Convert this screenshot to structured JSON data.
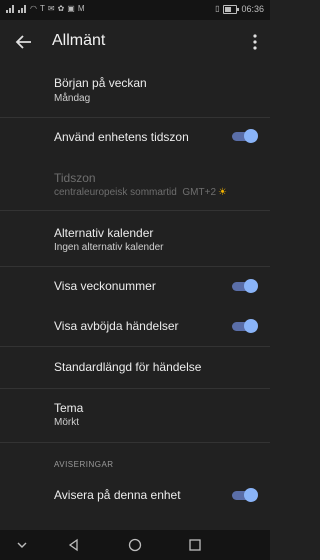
{
  "status_bar": {
    "carrier": "T",
    "time": "06:36"
  },
  "app_bar": {
    "title": "Allmänt"
  },
  "settings": {
    "week_start": {
      "title": "Början på veckan",
      "value": "Måndag"
    },
    "device_timezone": {
      "title": "Använd enhetens tidszon",
      "enabled": true
    },
    "timezone": {
      "title": "Tidszon",
      "value": "centraleuropeisk sommartid  GMT+2"
    },
    "alt_calendar": {
      "title": "Alternativ kalender",
      "value": "Ingen alternativ kalender"
    },
    "week_numbers": {
      "title": "Visa veckonummer",
      "enabled": true
    },
    "declined_events": {
      "title": "Visa avböjda händelser",
      "enabled": true
    },
    "default_duration": {
      "title": "Standardlängd för händelse"
    },
    "theme": {
      "title": "Tema",
      "value": "Mörkt"
    },
    "notifications_section": {
      "header": "AVISERINGAR"
    },
    "notify_device": {
      "title": "Avisera på denna enhet",
      "enabled": true
    }
  },
  "colors": {
    "accent": "#8ab4f8",
    "track": "#5a6ea8",
    "background": "#212121"
  }
}
